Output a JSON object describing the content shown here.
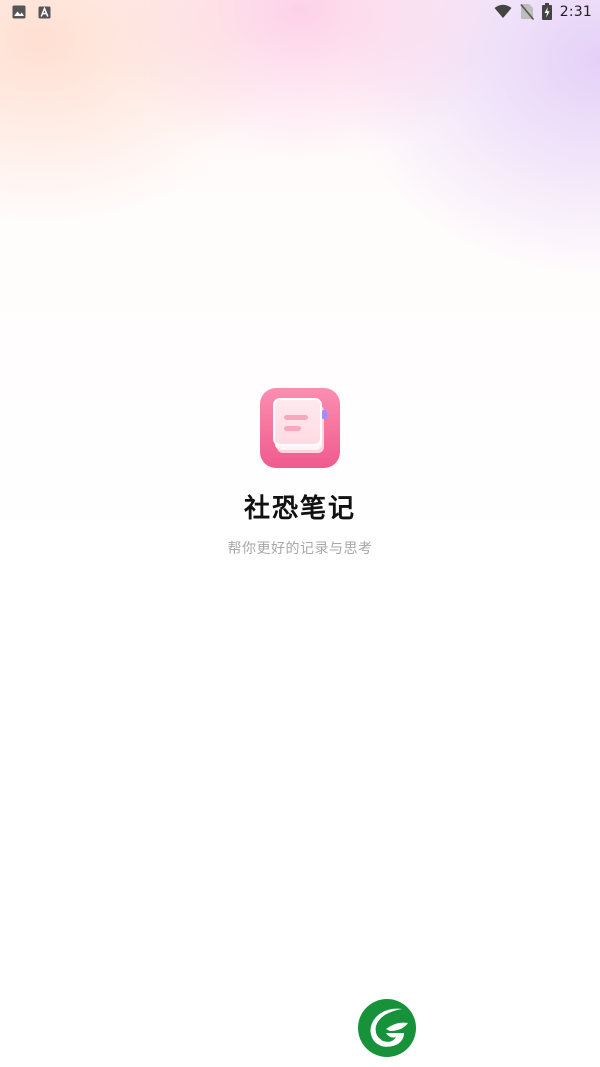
{
  "status_bar": {
    "time": "2:31",
    "left_icons": [
      "image-icon",
      "a-letter-icon"
    ],
    "right_icons": [
      "wifi-icon",
      "no-sim-icon",
      "battery-charging-icon"
    ]
  },
  "splash": {
    "app_name": "社恐笔记",
    "tagline": "帮你更好的记录与思考",
    "app_icon": "notebook-icon",
    "brand_logo": "green-leaf-g-logo"
  },
  "colors": {
    "icon_pink_top": "#fb8fb0",
    "icon_pink_bottom": "#f05a8e",
    "brand_green": "#16923a",
    "title": "#111111",
    "subtitle": "#a8a8a8"
  }
}
